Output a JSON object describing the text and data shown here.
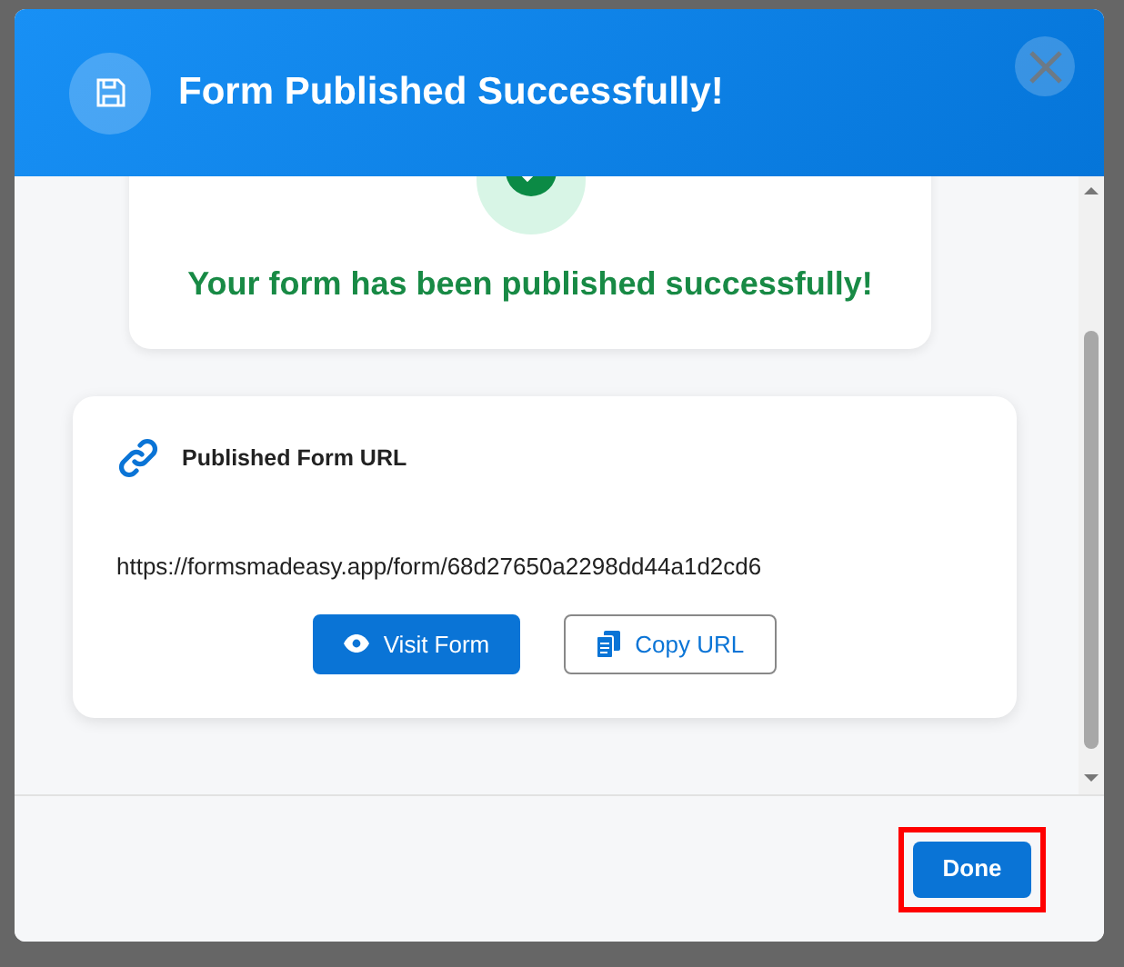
{
  "dialog": {
    "title": "Form Published Successfully!"
  },
  "success": {
    "message": "Your form has been published successfully!"
  },
  "url_card": {
    "title": "Published Form URL",
    "url": "https://formsmadeasy.app/form/68d27650a2298dd44a1d2cd6",
    "buttons": [
      {
        "label": "Visit Form",
        "kind": "primary"
      },
      {
        "label": "Copy URL",
        "kind": "outline"
      }
    ]
  },
  "footer": {
    "button": {
      "label": "Done",
      "highlighted": true
    }
  }
}
